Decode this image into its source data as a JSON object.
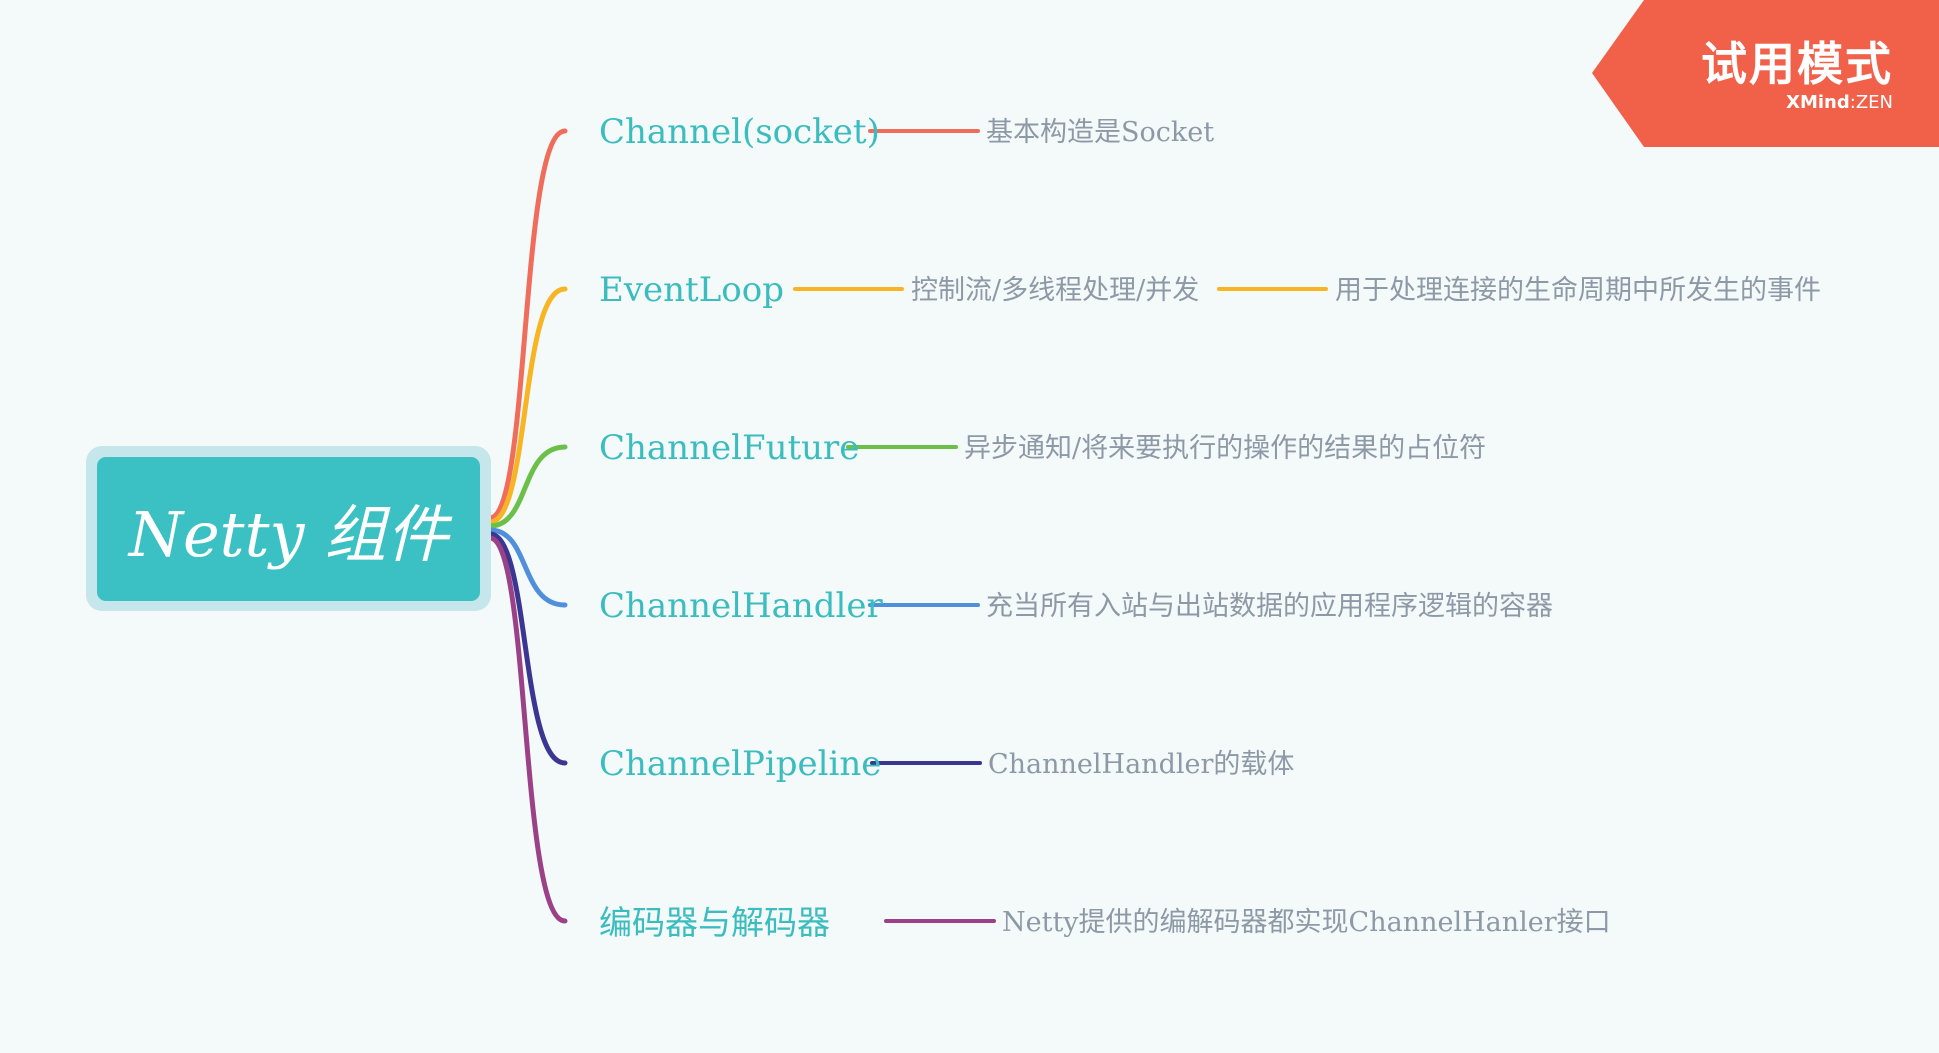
{
  "root": {
    "label": "Netty 组件"
  },
  "branches": [
    {
      "label": "Channel(socket)",
      "color": "#f06c5b",
      "children": [
        "基本构造是Socket"
      ]
    },
    {
      "label": "EventLoop",
      "color": "#f7b523",
      "children": [
        "控制流/多线程处理/并发",
        "用于处理连接的生命周期中所发生的事件"
      ]
    },
    {
      "label": "ChannelFuture",
      "color": "#6cc04a",
      "children": [
        "异步通知/将来要执行的操作的结果的占位符"
      ]
    },
    {
      "label": "ChannelHandler",
      "color": "#4f8fdc",
      "children": [
        "充当所有入站与出站数据的应用程序逻辑的容器"
      ]
    },
    {
      "label": "ChannelPipeline",
      "color": "#3b3692",
      "children": [
        "ChannelHandler的载体"
      ]
    },
    {
      "label": "编码器与解码器",
      "color": "#9b4187",
      "children": [
        "Netty提供的编解码器都实现ChannelHanler接口"
      ]
    }
  ],
  "watermark": {
    "title": "试用模式",
    "brand": "XMind",
    "edition": ":ZEN",
    "color": "#f1614a"
  }
}
